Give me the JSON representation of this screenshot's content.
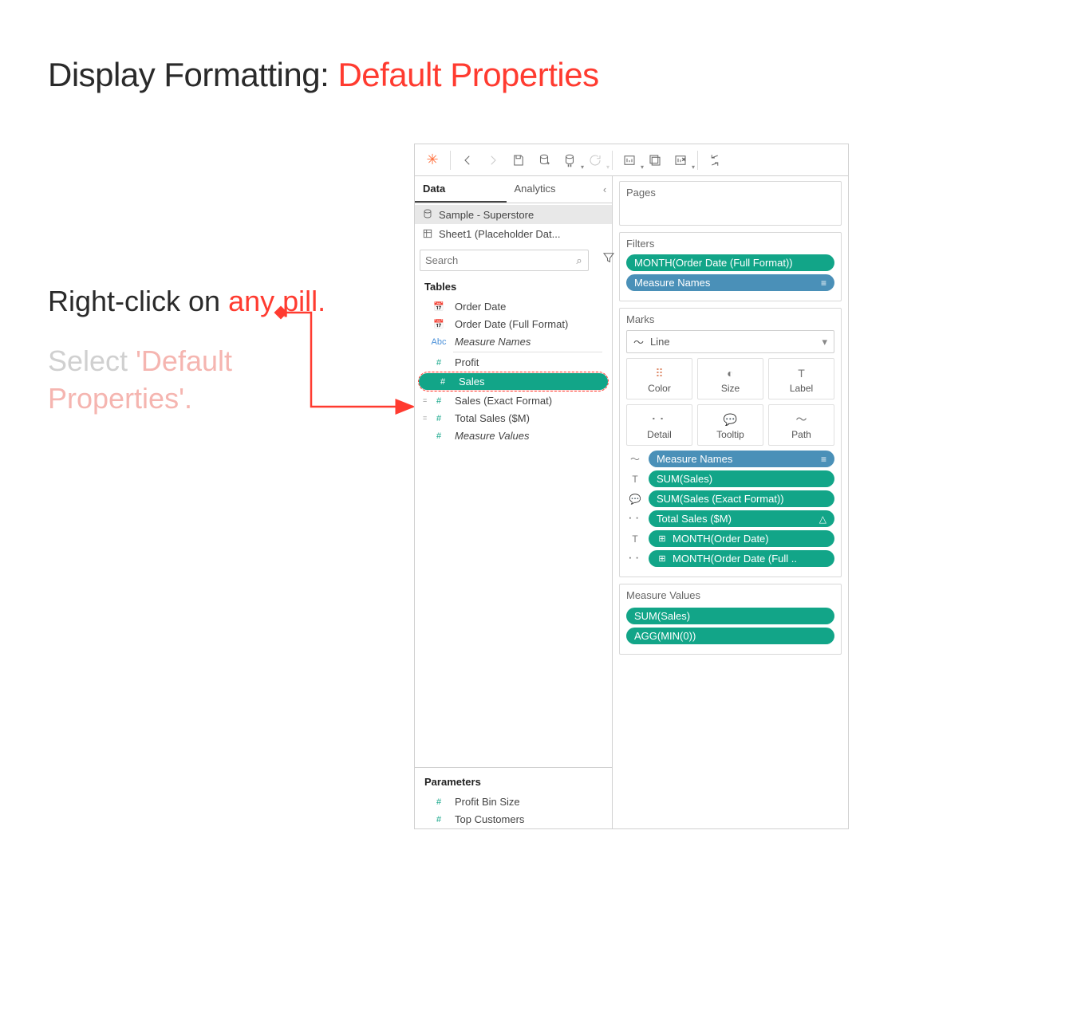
{
  "title_part1": "Display Formatting: ",
  "title_part2": "Default Properties",
  "instr1a": "Right-click on ",
  "instr1b": "any pill.",
  "instr2a": "Select ",
  "instr2b": "'Default Properties'.",
  "tabs": {
    "data": "Data",
    "analytics": "Analytics"
  },
  "datasources": {
    "a": "Sample - Superstore",
    "b": "Sheet1 (Placeholder Dat..."
  },
  "search_placeholder": "Search",
  "tables_hdr": "Tables",
  "fields": {
    "order_date": "Order Date",
    "order_date_full": "Order Date (Full Format)",
    "measure_names": "Measure Names",
    "profit": "Profit",
    "sales": "Sales",
    "sales_exact": "Sales (Exact Format)",
    "total_sales_m": "Total Sales ($M)",
    "measure_values": "Measure Values"
  },
  "params_hdr": "Parameters",
  "params": {
    "profit_bin": "Profit Bin Size",
    "top_cust": "Top Customers"
  },
  "shelves": {
    "pages": "Pages",
    "filters": "Filters",
    "marks": "Marks",
    "measure_values": "Measure Values"
  },
  "filter_pills": {
    "month": "MONTH(Order Date (Full Format))",
    "measure_names": "Measure Names"
  },
  "marks_type": "Line",
  "mark_cards": {
    "color": "Color",
    "size": "Size",
    "label": "Label",
    "detail": "Detail",
    "tooltip": "Tooltip",
    "path": "Path"
  },
  "mark_pills": {
    "mn": "Measure Names",
    "sum_sales": "SUM(Sales)",
    "sum_sales_exact": "SUM(Sales (Exact Format))",
    "total_sales": "Total Sales ($M)",
    "month_od": "MONTH(Order Date)",
    "month_od_full": "MONTH(Order Date (Full .."
  },
  "mv_pills": {
    "sum_sales": "SUM(Sales)",
    "agg_min0": "AGG(MIN(0))"
  }
}
